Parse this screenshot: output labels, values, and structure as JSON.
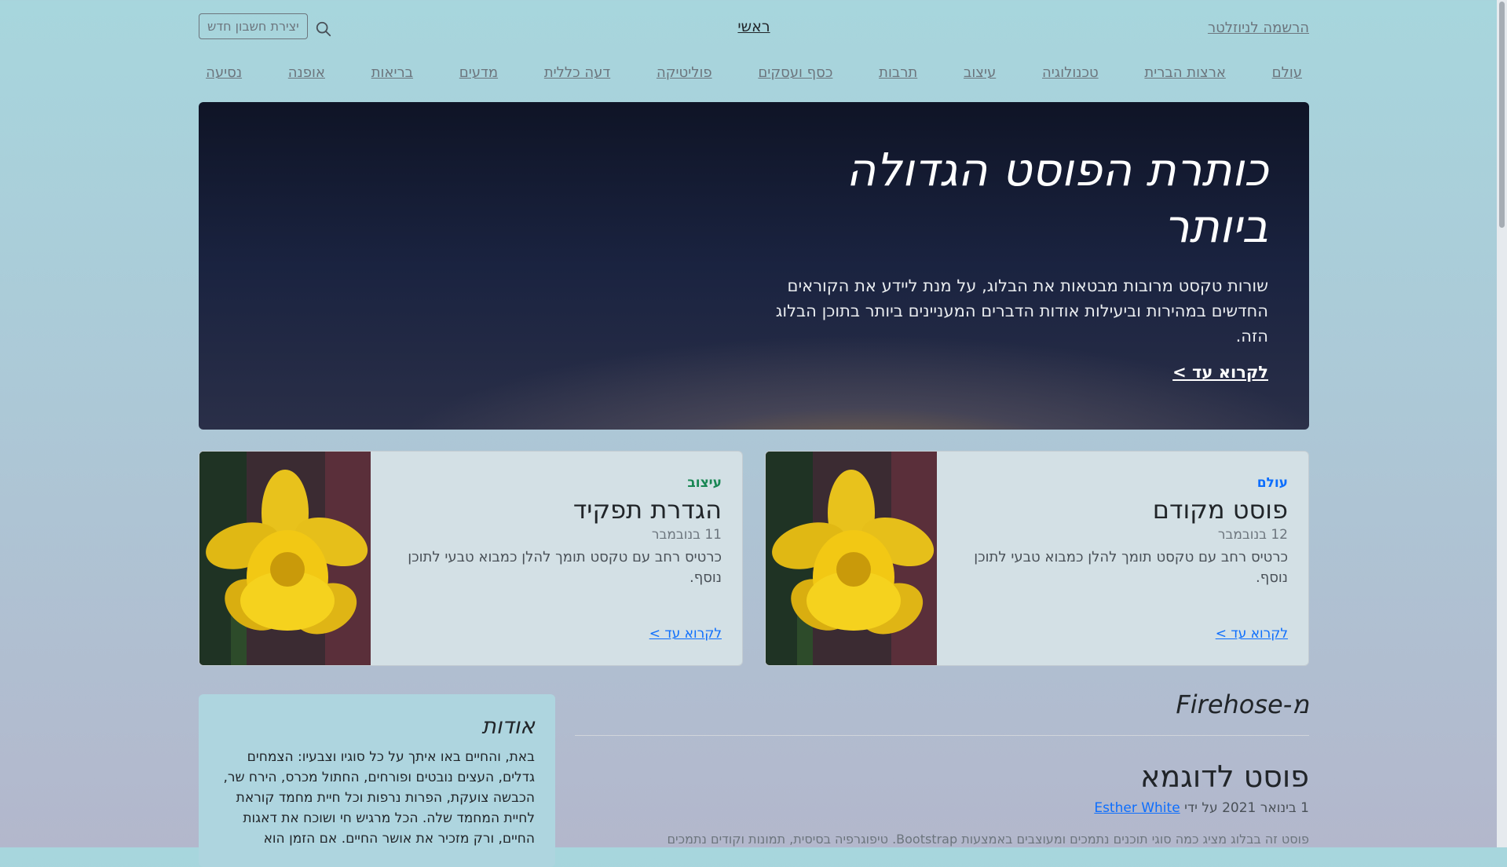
{
  "header": {
    "newsletter_label": "הרשמה לניוזלטר",
    "brand_label": "ראשי",
    "signup_label": "יצירת חשבון חדש"
  },
  "nav": {
    "items": [
      "עולם",
      "ארצות הברית",
      "טכנולוגיה",
      "עיצוב",
      "תרבות",
      "כסף ועסקים",
      "פוליטיקה",
      "דעה כללית",
      "מדעים",
      "בריאות",
      "אופנה",
      "נסיעה"
    ]
  },
  "hero": {
    "title": "כותרת הפוסט הגדולה ביותר",
    "lead": "שורות טקסט מרובות מבטאות את הבלוג, על מנת ליידע את הקוראים החדשים במהירות וביעילות אודות הדברים המעניינים ביותר בתוכן הבלוג הזה.",
    "link_label": "לקרוא עד >"
  },
  "cards": [
    {
      "category": "עולם",
      "category_color": "#0d6efd",
      "title": "פוסט מקודם",
      "date": "12 בנובמבר",
      "text": "כרטיס רחב עם טקסט תומך להלן כמבוא טבעי לתוכן נוסף.",
      "link_label": "לקרוא עד >"
    },
    {
      "category": "עיצוב",
      "category_color": "#198754",
      "title": "הגדרת תפקיד",
      "date": "11 בנובמבר",
      "text": "כרטיס רחב עם טקסט תומך להלן כמבוא טבעי לתוכן נוסף.",
      "link_label": "לקרוא עד >"
    }
  ],
  "firehose": {
    "title": "מ-Firehose",
    "post_title": "פוסט לדוגמא",
    "post_date": "1 בינואר 2021 על ידי",
    "post_author": "Esther White",
    "post_snippet": "פוסט זה בבלוג מציג כמה סוגי תוכנים נתמכים ומעוצבים באמצעות Bootstrap. טיפוגרפיה בסיסית, תמונות וקודים נתמכים"
  },
  "about": {
    "title": "אודות",
    "text": "באת, והחיים באו איתך על כל סוגיו וצבעיו: הצמחים גדלים, העצים נובטים ופורחים, החתול מכרס, הירח שר, הכבשה צועקת, הפרות נרפות וכל חיית מחמד קוראת לחיית המחמד שלה. הכל מרגיש חי ושוכח את דאגות החיים, ורק מזכיר את אושר החיים. אם הזמן הוא"
  }
}
